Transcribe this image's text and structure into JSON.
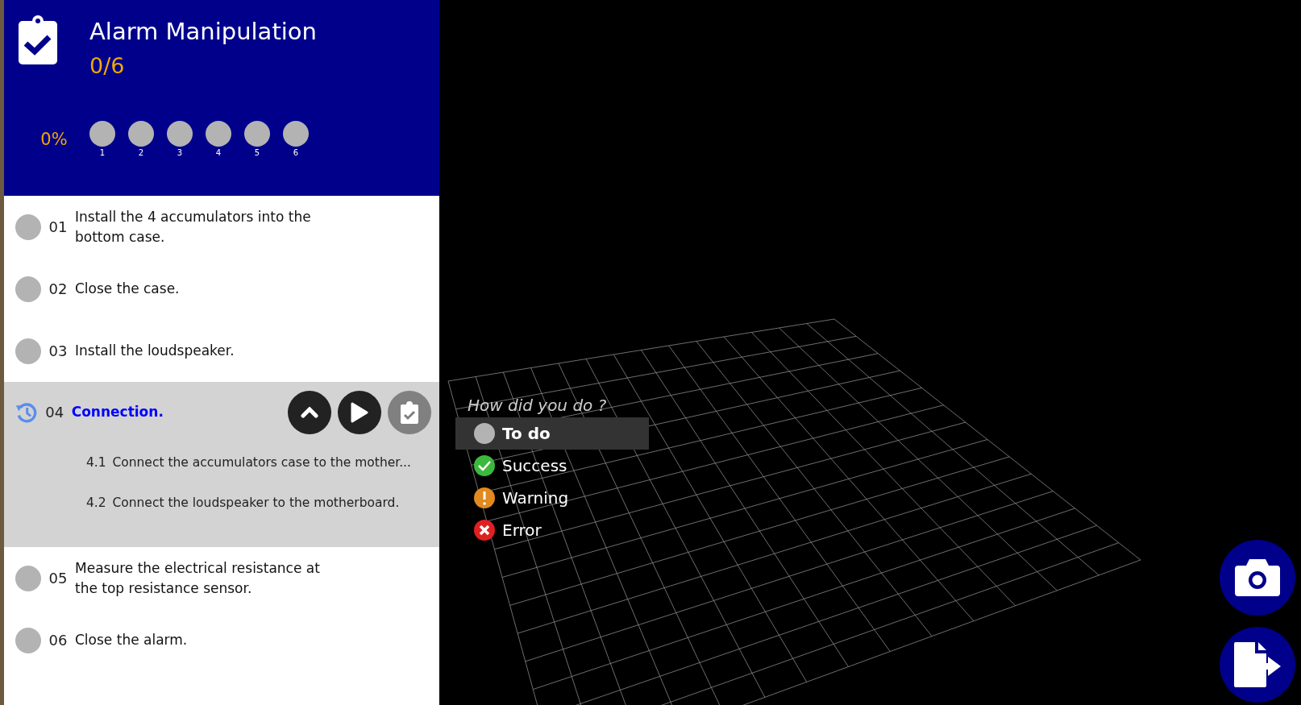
{
  "header": {
    "title": "Alarm Manipulation",
    "count": "0/6",
    "percent": "0%",
    "progress_dots": [
      {
        "label": "1",
        "done": false
      },
      {
        "label": "2",
        "done": false
      },
      {
        "label": "3",
        "done": false
      },
      {
        "label": "4",
        "done": false
      },
      {
        "label": "5",
        "done": false
      },
      {
        "label": "6",
        "done": false
      }
    ]
  },
  "steps": [
    {
      "number": "01",
      "text": "Install the 4 accumulators into the bottom case.",
      "kind": "todo"
    },
    {
      "number": "02",
      "text": "Close the case.",
      "kind": "todo"
    },
    {
      "number": "03",
      "text": "Install the loudspeaker.",
      "kind": "todo"
    },
    {
      "number": "04",
      "text": "Connection.",
      "kind": "current",
      "expanded": true,
      "children": [
        {
          "number": "4.1",
          "text": "Connect the accumulators case to the mother..."
        },
        {
          "number": "4.2",
          "text": "Connect the loudspeaker to the motherboard."
        }
      ]
    },
    {
      "number": "05",
      "text": "Measure the electrical resistance at the top resistance sensor.",
      "kind": "todo"
    },
    {
      "number": "06",
      "text": "Close the alarm.",
      "kind": "todo"
    }
  ],
  "result_menu": {
    "prompt": "How did you do ?",
    "options": [
      {
        "label": "To do",
        "kind": "todo",
        "selected": true
      },
      {
        "label": "Success",
        "kind": "success",
        "selected": false
      },
      {
        "label": "Warning",
        "kind": "warning",
        "selected": false
      },
      {
        "label": "Error",
        "kind": "error",
        "selected": false
      }
    ]
  }
}
